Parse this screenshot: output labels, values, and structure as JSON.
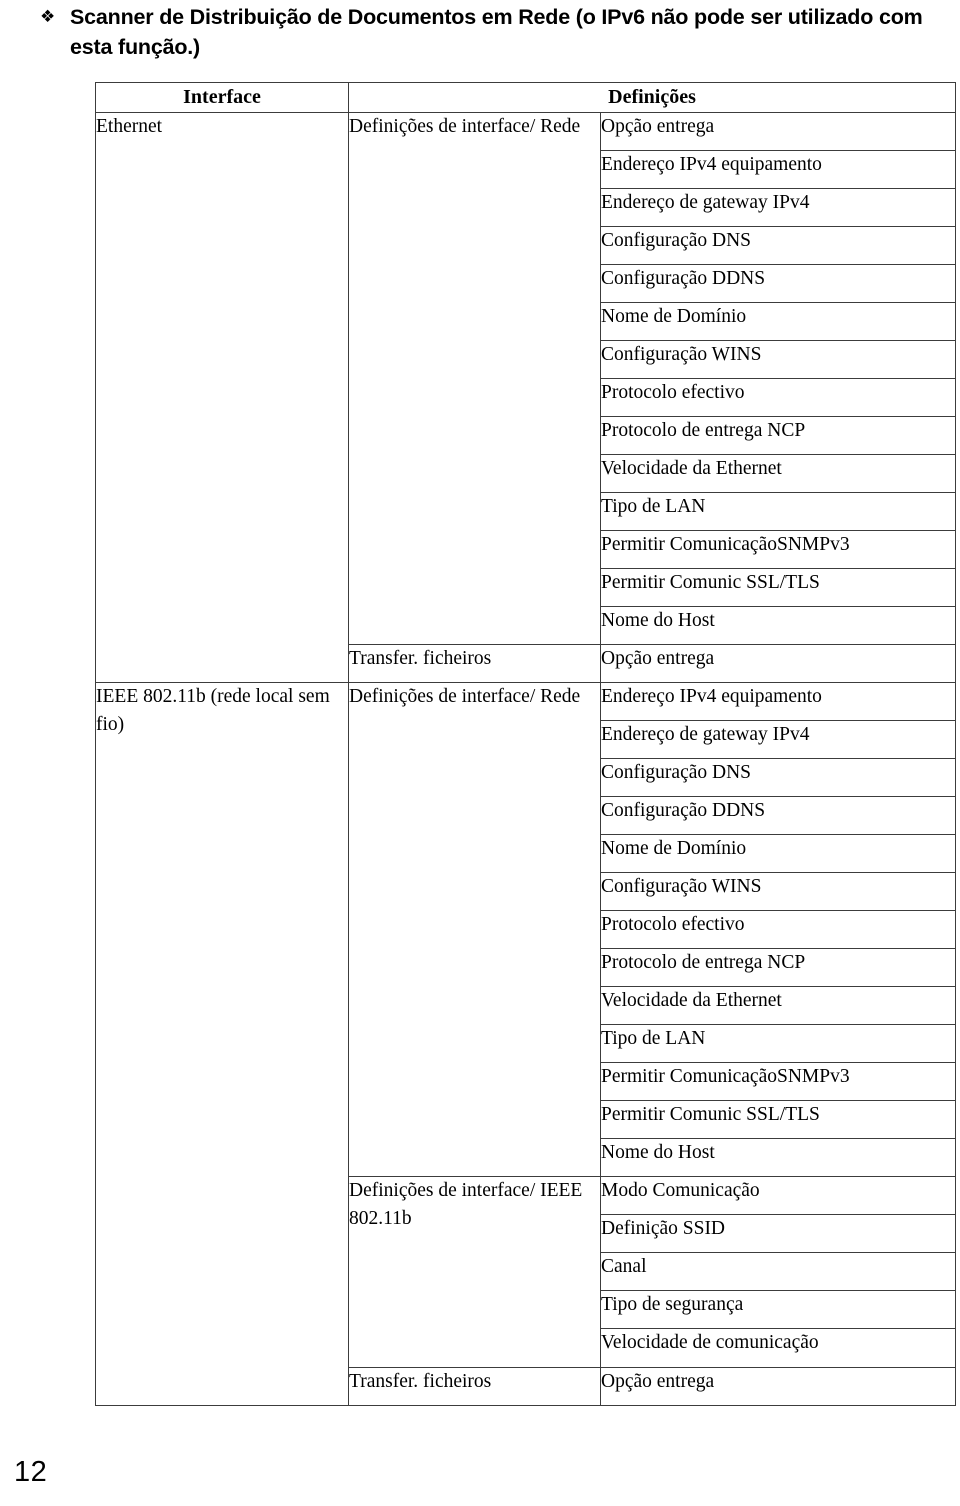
{
  "heading": {
    "bullet_icon": "diamond-cluster-bullet",
    "bullet_glyph": "❖",
    "text": "Scanner de Distribuição de Documentos em Rede (o IPv6 não pode ser utilizado com esta função.)"
  },
  "table": {
    "headers": {
      "interface": "Interface",
      "settings": "Definições"
    },
    "interfaces": [
      {
        "name": "Ethernet",
        "groups": [
          {
            "label": "Definições de interface/ Rede",
            "items": [
              "Opção entrega",
              "Endereço IPv4 equipamento",
              "Endereço de gateway IPv4",
              "Configuração DNS",
              "Configuração DDNS",
              "Nome de Domínio",
              "Configuração WINS",
              "Protocolo efectivo",
              "Protocolo de entrega NCP",
              "Velocidade da Ethernet",
              "Tipo de LAN",
              "Permitir ComunicaçãoSNMPv3",
              "Permitir Comunic SSL/TLS",
              "Nome do Host"
            ]
          },
          {
            "label": "Transfer. ficheiros",
            "items": [
              "Opção entrega"
            ]
          }
        ]
      },
      {
        "name": "IEEE 802.11b (rede local sem fio)",
        "groups": [
          {
            "label": "Definições de interface/ Rede",
            "items": [
              "Endereço IPv4 equipamento",
              "Endereço de gateway IPv4",
              "Configuração DNS",
              "Configuração DDNS",
              "Nome de Domínio",
              "Configuração WINS",
              "Protocolo efectivo",
              "Protocolo de entrega NCP",
              "Velocidade da Ethernet",
              "Tipo de LAN",
              "Permitir ComunicaçãoSNMPv3",
              "Permitir Comunic SSL/TLS",
              "Nome do Host"
            ]
          },
          {
            "label": "Definições de interface/ IEEE 802.11b",
            "items": [
              "Modo Comunicação",
              "Definição SSID",
              "Canal",
              "Tipo de segurança",
              "Velocidade de comunicação"
            ]
          },
          {
            "label": "Transfer. ficheiros",
            "items": [
              "Opção entrega"
            ]
          }
        ]
      }
    ]
  },
  "footer": {
    "page_number": "12"
  }
}
